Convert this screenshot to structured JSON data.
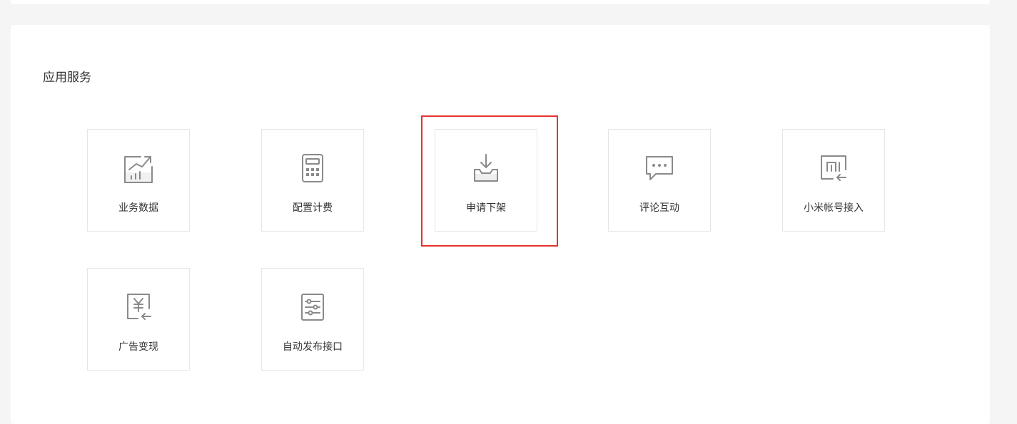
{
  "section": {
    "title": "应用服务"
  },
  "tiles": [
    {
      "label": "业务数据",
      "icon": "business-data-chart-icon"
    },
    {
      "label": "配置计费",
      "icon": "calculator-icon"
    },
    {
      "label": "申请下架",
      "icon": "inbox-download-icon"
    },
    {
      "label": "评论互动",
      "icon": "comment-bubble-icon"
    },
    {
      "label": "小米帐号接入",
      "icon": "mi-account-icon"
    },
    {
      "label": "广告变现",
      "icon": "yen-return-icon"
    },
    {
      "label": "自动发布接口",
      "icon": "sliders-list-icon"
    }
  ],
  "colors": {
    "icon_stroke": "#8a8a8a",
    "highlight": "#e5322d",
    "tile_border": "#e6e6e6",
    "page_bg": "#f5f5f5"
  }
}
